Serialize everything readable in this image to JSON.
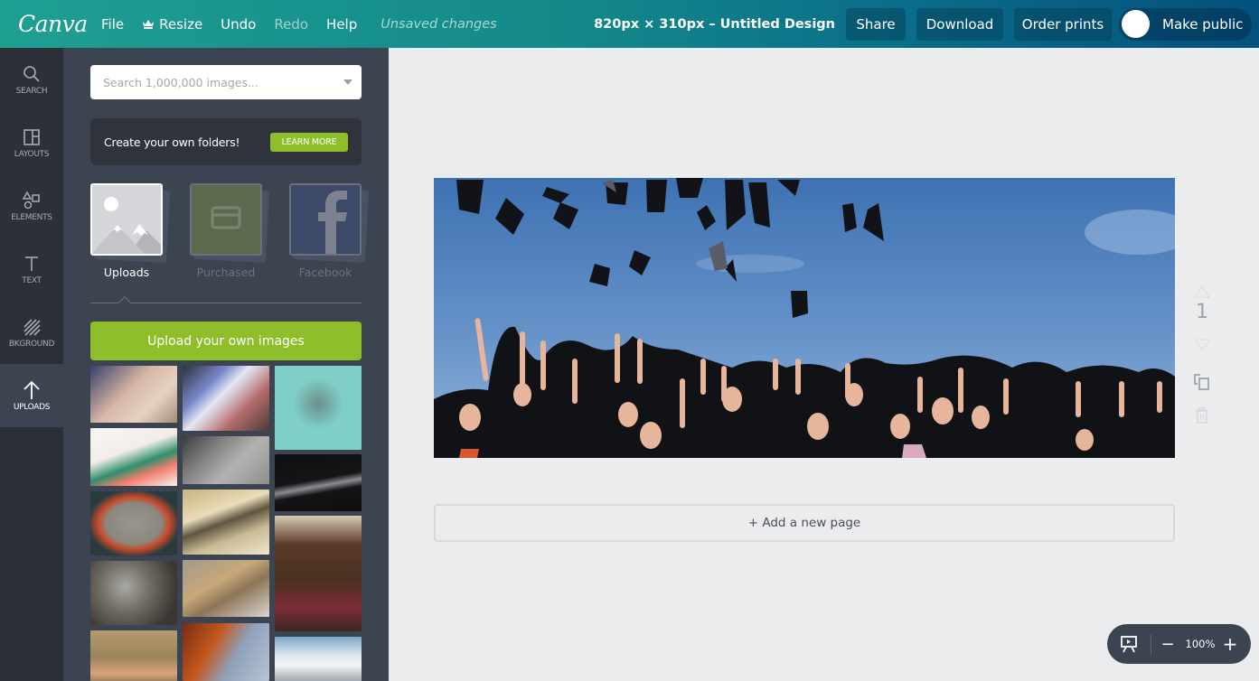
{
  "topbar": {
    "logo": "Canva",
    "menu": {
      "file": "File",
      "resize": "Resize",
      "undo": "Undo",
      "redo": "Redo",
      "help": "Help"
    },
    "status": "Unsaved changes",
    "design_title": "820px × 310px – Untitled Design",
    "share": "Share",
    "download": "Download",
    "order_prints": "Order prints",
    "make_public": "Make public",
    "make_public_on": false
  },
  "rail": {
    "items": [
      {
        "label": "SEARCH",
        "icon": "search-icon"
      },
      {
        "label": "LAYOUTS",
        "icon": "layouts-icon"
      },
      {
        "label": "ELEMENTS",
        "icon": "elements-icon"
      },
      {
        "label": "TEXT",
        "icon": "text-icon"
      },
      {
        "label": "BKGROUND",
        "icon": "background-icon"
      },
      {
        "label": "UPLOADS",
        "icon": "upload-arrow-icon",
        "active": true
      }
    ]
  },
  "panel": {
    "search_placeholder": "Search 1,000,000 images...",
    "promo_text": "Create your own folders!",
    "learn_more": "LEARN MORE",
    "sources": [
      {
        "label": "Uploads",
        "active": true
      },
      {
        "label": "Purchased",
        "active": false
      },
      {
        "label": "Facebook",
        "active": false
      }
    ],
    "upload_button": "Upload your own images",
    "thumbnails": [
      "laptop-hands",
      "presentation-screen",
      "hand-sketch-teal",
      "paper-craft",
      "pencil-sketch",
      "scalpel",
      "screen-frame",
      "pen-nibs",
      "printing-press",
      "metal-weights",
      "tied-papers",
      "rock-climber",
      "climbing-wall",
      "cliff-climber",
      "ski-lift"
    ]
  },
  "canvas": {
    "image_alt": "Graduates throwing caps in the air",
    "add_page": "+ Add a new page",
    "page_number": "1"
  },
  "zoom": {
    "minus": "−",
    "level": "100%",
    "plus": "+"
  },
  "colors": {
    "accent_green": "#8ebf2b",
    "topbar_start": "#1f9f92",
    "topbar_end": "#04507d",
    "panel_bg": "#3d4451",
    "rail_bg": "#2c3039"
  }
}
